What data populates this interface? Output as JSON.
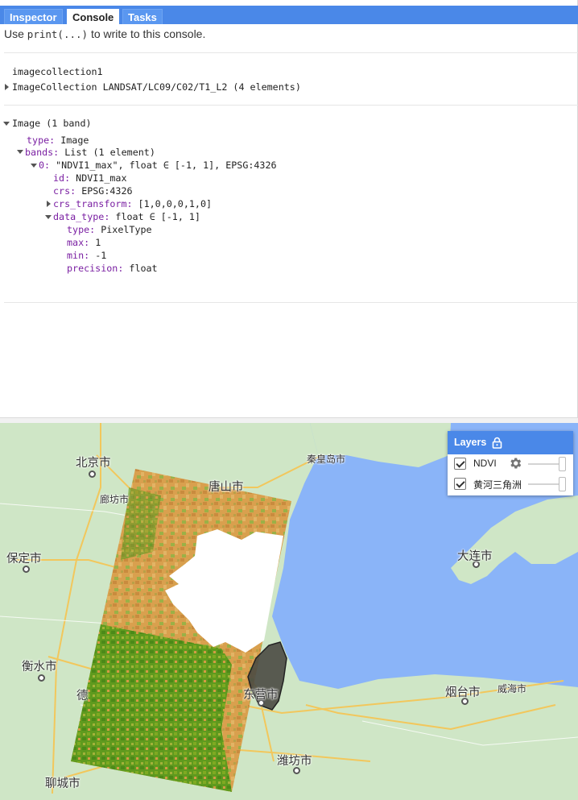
{
  "tabs": [
    {
      "label": "Inspector"
    },
    {
      "label": "Console"
    },
    {
      "label": "Tasks"
    }
  ],
  "console": {
    "hint_prefix": "Use ",
    "hint_code": "print(...)",
    "hint_suffix": " to write to this console.",
    "block1": {
      "label": "imagecollection1",
      "summary": "ImageCollection LANDSAT/LC09/C02/T1_L2 (4 elements)"
    },
    "block2": {
      "root": "Image (1 band)",
      "type_key": "type:",
      "type_val": " Image",
      "bands_key": "bands:",
      "bands_val": " List (1 element)",
      "band0_key": "0:",
      "band0_val": " \"NDVI1_max\", float ∈ [-1, 1], EPSG:4326",
      "id_key": "id:",
      "id_val": " NDVI1_max",
      "crs_key": "crs:",
      "crs_val": " EPSG:4326",
      "crs_transform_key": "crs_transform:",
      "crs_transform_val": " [1,0,0,0,1,0]",
      "data_type_key": "data_type:",
      "data_type_val": " float ∈ [-1, 1]",
      "dt_type_key": "type:",
      "dt_type_val": " PixelType",
      "max_key": "max:",
      "max_val": " 1",
      "min_key": "min:",
      "min_val": " -1",
      "precision_key": "precision:",
      "precision_val": " float"
    }
  },
  "map": {
    "places": [
      {
        "name": "北京市"
      },
      {
        "name": "秦皇岛市"
      },
      {
        "name": "廊坊市"
      },
      {
        "name": "唐山市"
      },
      {
        "name": "保定市"
      },
      {
        "name": "大连市"
      },
      {
        "name": "衡水市"
      },
      {
        "name": "德"
      },
      {
        "name": "东营市"
      },
      {
        "name": "烟台市"
      },
      {
        "name": "威海市"
      },
      {
        "name": "潍坊市"
      },
      {
        "name": "聊城市"
      }
    ],
    "colors": {
      "water": "#8ab4f8",
      "land": "#cfe6c6",
      "accent": "#4a88e8"
    }
  },
  "layers": {
    "title": "Layers",
    "items": [
      {
        "name": "NDVI",
        "checked": true
      },
      {
        "name": "黄河三角洲",
        "checked": true
      }
    ]
  }
}
